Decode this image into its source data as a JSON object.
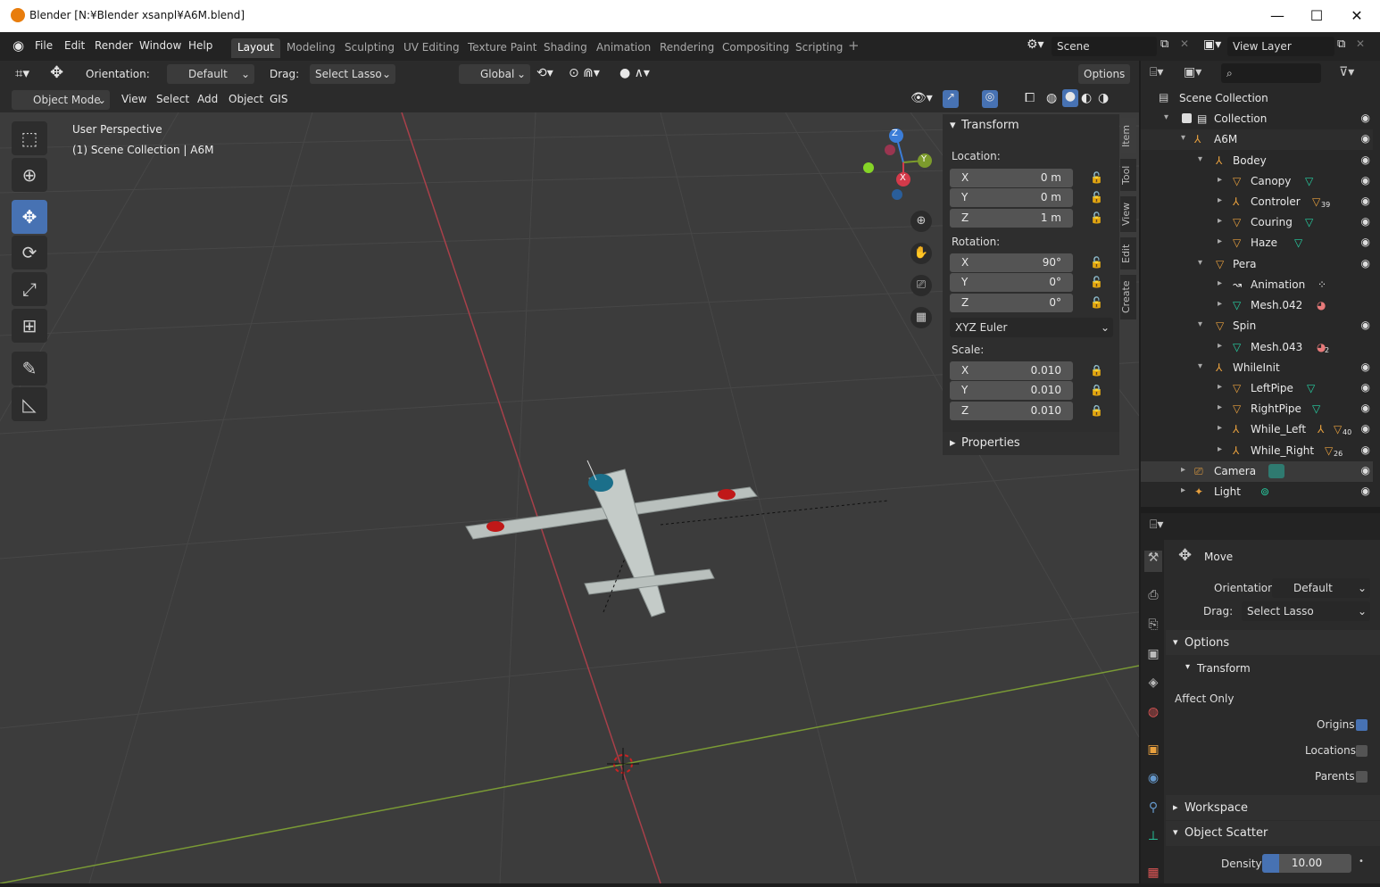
{
  "window": {
    "title": "Blender [N:¥Blender xsanpl¥A6M.blend]",
    "minimize": "—",
    "maximize": "☐",
    "close": "✕"
  },
  "menu": {
    "items": [
      "File",
      "Edit",
      "Render",
      "Window",
      "Help"
    ]
  },
  "workspaces": [
    "Layout",
    "Modeling",
    "Sculpting",
    "UV Editing",
    "Texture Paint",
    "Shading",
    "Animation",
    "Rendering",
    "Compositing",
    "Scripting"
  ],
  "active_workspace": "Layout",
  "scene": {
    "label": "Scene",
    "view_layer": "View Layer"
  },
  "header": {
    "orientation_label": "Orientation:",
    "orientation_value": "Default",
    "drag_label": "Drag:",
    "drag_value": "Select Lasso",
    "transform_value": "Global",
    "options_label": "Options"
  },
  "header2": {
    "mode": "Object Mode",
    "items": [
      "View",
      "Select",
      "Add",
      "Object",
      "GIS"
    ]
  },
  "viewport": {
    "overlay_line1": "User Perspective",
    "overlay_line2": "(1) Scene Collection | A6M",
    "gizmo": {
      "z": "Z",
      "y": "Y",
      "x": "X"
    }
  },
  "npanel": {
    "transform_title": "Transform",
    "location_label": "Location:",
    "location": [
      {
        "axis": "X",
        "value": "0 m"
      },
      {
        "axis": "Y",
        "value": "0 m"
      },
      {
        "axis": "Z",
        "value": "1 m"
      }
    ],
    "rotation_label": "Rotation:",
    "rotation": [
      {
        "axis": "X",
        "value": "90°"
      },
      {
        "axis": "Y",
        "value": "0°"
      },
      {
        "axis": "Z",
        "value": "0°"
      }
    ],
    "rotation_mode": "XYZ Euler",
    "scale_label": "Scale:",
    "scale": [
      {
        "axis": "X",
        "value": "0.010"
      },
      {
        "axis": "Y",
        "value": "0.010"
      },
      {
        "axis": "Z",
        "value": "0.010"
      }
    ],
    "properties_title": "Properties",
    "tabs": [
      "Item",
      "Tool",
      "View",
      "Edit",
      "Create"
    ]
  },
  "outliner": {
    "root": "Scene Collection",
    "rows": [
      {
        "name": "Collection"
      },
      {
        "name": "A6M"
      },
      {
        "name": "Bodey"
      },
      {
        "name": "Canopy"
      },
      {
        "name": "Controler",
        "badge": "39"
      },
      {
        "name": "Couring"
      },
      {
        "name": "Haze"
      },
      {
        "name": "Pera"
      },
      {
        "name": "Animation"
      },
      {
        "name": "Mesh.042"
      },
      {
        "name": "Spin"
      },
      {
        "name": "Mesh.043",
        "badge": "2"
      },
      {
        "name": "WhileInit"
      },
      {
        "name": "LeftPipe"
      },
      {
        "name": "RightPipe"
      },
      {
        "name": "While_Left",
        "badge": "40"
      },
      {
        "name": "While_Right",
        "badge": "26"
      },
      {
        "name": "Camera"
      },
      {
        "name": "Light"
      }
    ]
  },
  "props": {
    "tool_name": "Move",
    "orientation_label": "Orientation",
    "orientation_value": "Default",
    "drag_label": "Drag:",
    "drag_value": "Select Lasso",
    "options_title": "Options",
    "transform_title": "Transform",
    "affect_only": "Affect Only",
    "origins": "Origins",
    "locations": "Locations",
    "parents": "Parents",
    "workspace_title": "Workspace",
    "scatter_title": "Object Scatter",
    "density_label": "Density",
    "density_value": "10.00"
  }
}
